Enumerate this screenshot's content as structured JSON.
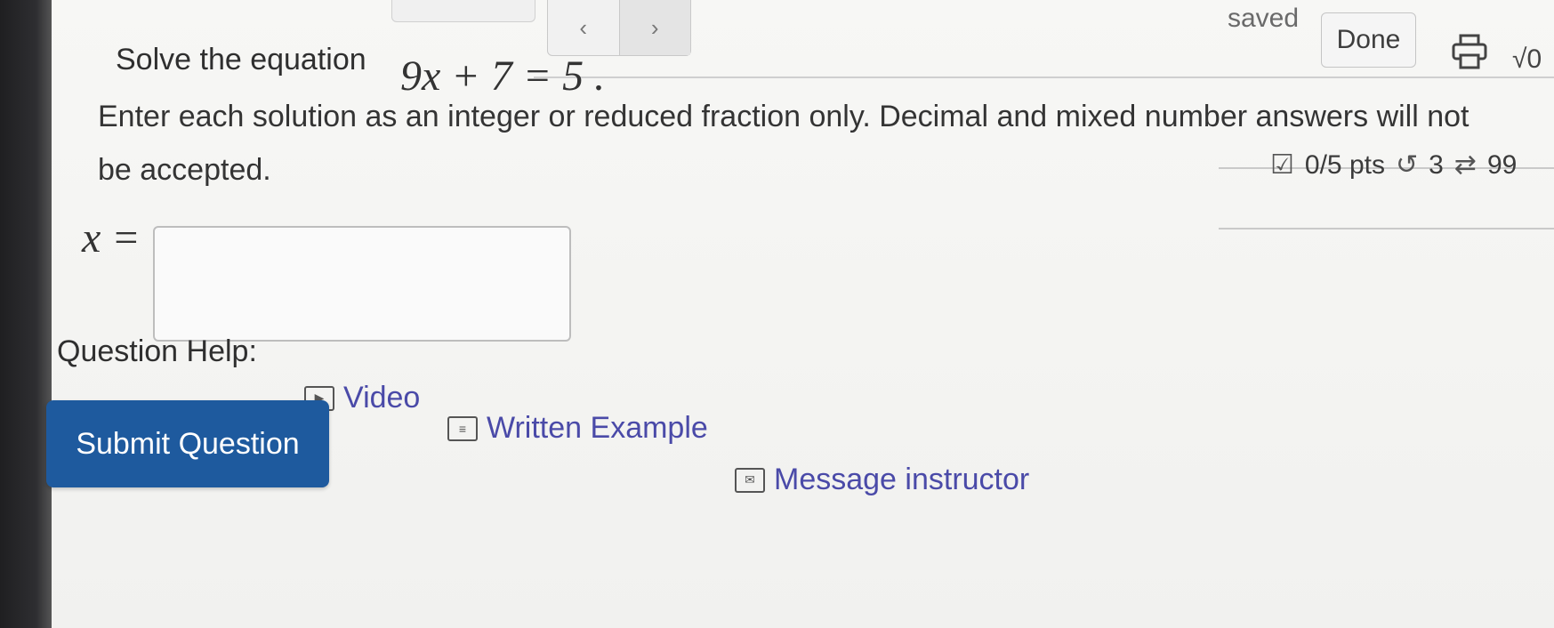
{
  "topbar": {
    "nav_prev": "‹",
    "nav_next": "›",
    "saved_text": "saved",
    "done_label": "Done",
    "math_icon": "√0"
  },
  "question": {
    "prompt": "Solve the equation",
    "equation": "9x + 7 = 5 .",
    "instruction_line1": "Enter each solution as an integer or reduced fraction only.  Decimal and mixed number answers will not",
    "instruction_line2": "be accepted.",
    "answer_label": "x =",
    "answer_value": ""
  },
  "status": {
    "points": "0/5 pts",
    "retries": "3",
    "attempts": "99"
  },
  "help": {
    "label": "Question Help:",
    "video": "Video",
    "written_example": "Written Example",
    "message_instructor": "Message instructor"
  },
  "submit": {
    "label": "Submit Question",
    "color": "#1e5a9e"
  },
  "icons": [
    "chevron-left-icon",
    "chevron-right-icon",
    "print-icon",
    "sqrt-icon",
    "checkbox-icon",
    "retry-icon",
    "repeat-icon",
    "video-icon",
    "document-icon",
    "mail-icon"
  ]
}
